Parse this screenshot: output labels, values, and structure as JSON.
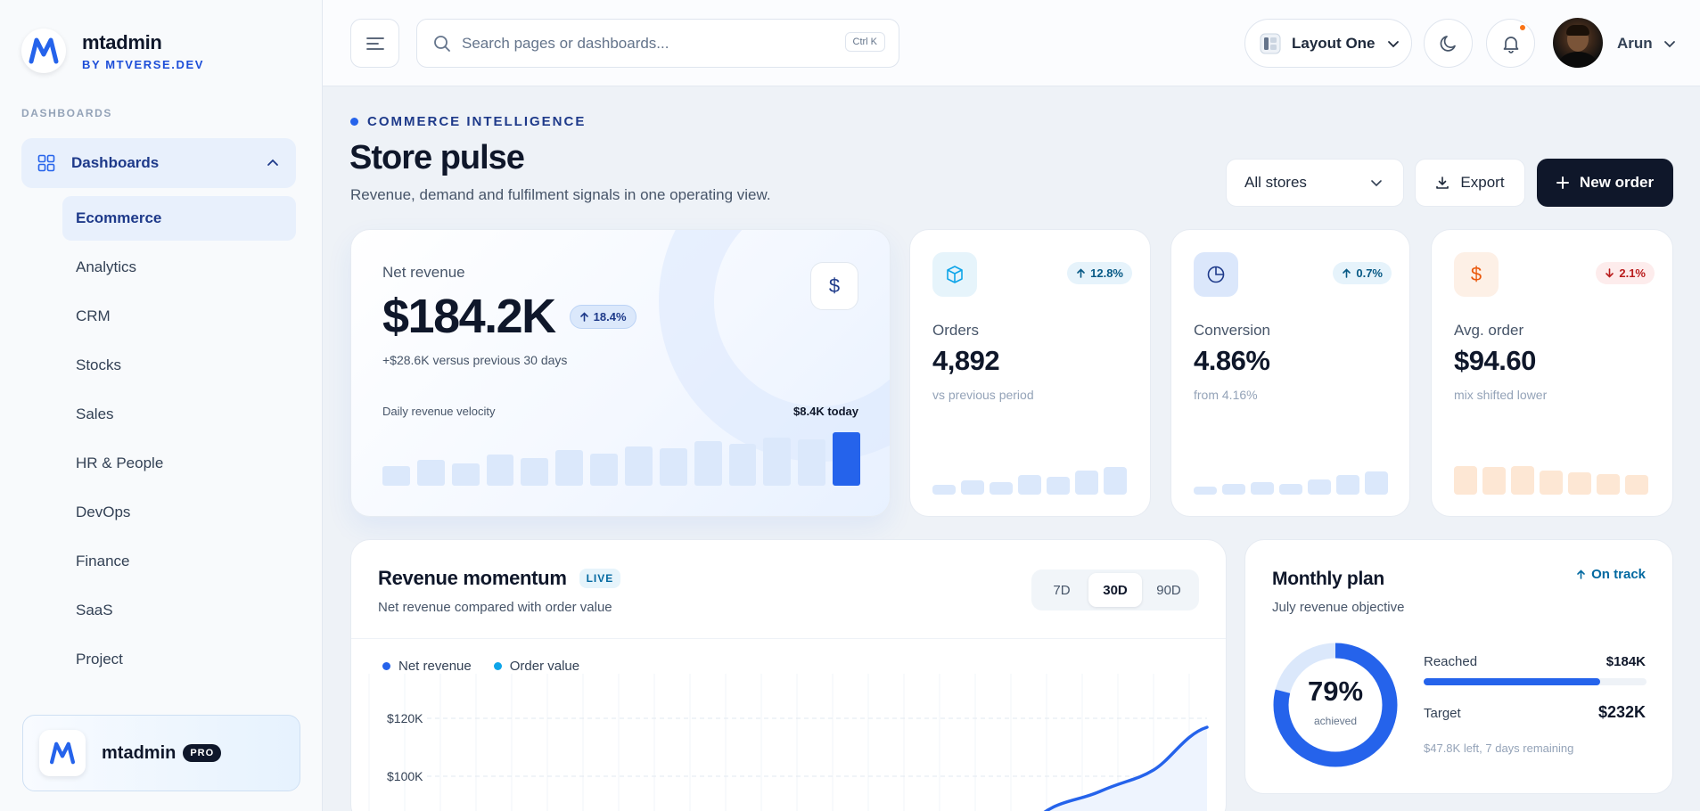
{
  "brand": {
    "name": "mtadmin",
    "sub": "BY MTVERSE.DEV"
  },
  "sidebar": {
    "section": "DASHBOARDS",
    "group_label": "Dashboards",
    "items": [
      {
        "label": "Ecommerce",
        "active": true
      },
      {
        "label": "Analytics"
      },
      {
        "label": "CRM"
      },
      {
        "label": "Stocks"
      },
      {
        "label": "Sales"
      },
      {
        "label": "HR & People"
      },
      {
        "label": "DevOps"
      },
      {
        "label": "Finance"
      },
      {
        "label": "SaaS"
      },
      {
        "label": "Project"
      }
    ],
    "promo": {
      "name": "mtadmin",
      "badge": "PRO"
    }
  },
  "topbar": {
    "search_placeholder": "Search pages or dashboards...",
    "shortcut": "Ctrl K",
    "layout": "Layout One",
    "user": "Arun"
  },
  "page": {
    "eyebrow": "COMMERCE INTELLIGENCE",
    "title": "Store pulse",
    "subtitle": "Revenue, demand and fulfilment signals in one operating view.",
    "store_filter": "All stores",
    "export_label": "Export",
    "new_order_label": "New order"
  },
  "hero": {
    "label": "Net revenue",
    "value": "$184.2K",
    "change": "18.4%",
    "comparison": "+$28.6K versus previous 30 days",
    "velocity_label": "Daily revenue velocity",
    "today": "$8.4K today",
    "icon": "dollar-icon",
    "bar_levels": [
      0.36,
      0.48,
      0.42,
      0.58,
      0.52,
      0.66,
      0.6,
      0.74,
      0.7,
      0.84,
      0.78,
      0.9,
      0.86,
      1.0
    ]
  },
  "kpis": [
    {
      "key": "orders",
      "label": "Orders",
      "value": "4,892",
      "change": "12.8%",
      "direction": "up",
      "note": "vs previous period",
      "icon": "box-icon",
      "accent": "#0ea5e9",
      "bars": [
        0.3,
        0.45,
        0.4,
        0.6,
        0.55,
        0.75,
        0.85
      ]
    },
    {
      "key": "conversion",
      "label": "Conversion",
      "value": "4.86%",
      "change": "0.7%",
      "direction": "up",
      "note": "from 4.16%",
      "icon": "pie-icon",
      "accent": "#2563eb",
      "bars": [
        0.25,
        0.32,
        0.38,
        0.33,
        0.48,
        0.62,
        0.72
      ]
    },
    {
      "key": "avg_order",
      "label": "Avg. order",
      "value": "$94.60",
      "change": "2.1%",
      "direction": "down",
      "note": "mix shifted lower",
      "icon": "dollar-icon",
      "accent": "#ea580c",
      "bars": [
        0.9,
        0.85,
        0.88,
        0.75,
        0.7,
        0.65,
        0.6
      ]
    }
  ],
  "revenue": {
    "title": "Revenue momentum",
    "badge": "LIVE",
    "subtitle": "Net revenue compared with order value",
    "ranges": [
      "7D",
      "30D",
      "90D"
    ],
    "selected_range": "30D",
    "legend": [
      "Net revenue",
      "Order value"
    ],
    "y_ticks": [
      "$120K",
      "$100K"
    ]
  },
  "chart_data": {
    "type": "line",
    "series": [
      {
        "name": "Net revenue",
        "color": "#2563eb"
      },
      {
        "name": "Order value",
        "color": "#0ea5e9"
      }
    ],
    "y_ticks": [
      "$120K",
      "$100K"
    ]
  },
  "plan": {
    "title": "Monthly plan",
    "status": "On track",
    "subtitle": "July revenue objective",
    "percent": "79%",
    "percent_value": 0.79,
    "achieved_label": "achieved",
    "reached_label": "Reached",
    "reached_value": "$184K",
    "target_label": "Target",
    "target_value": "$232K",
    "remaining": "$47.8K left, 7 days remaining"
  },
  "colors": {
    "accent": "#2563eb",
    "dark": "#0f172a",
    "notification": "#f97316"
  }
}
